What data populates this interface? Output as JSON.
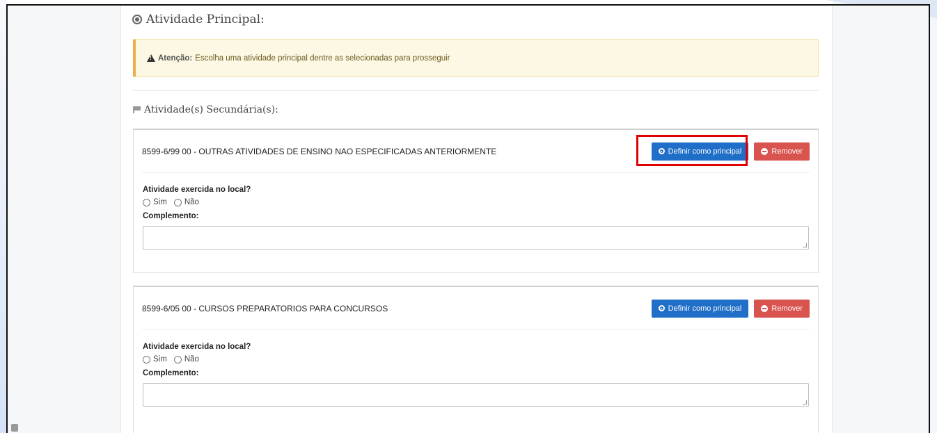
{
  "page": {
    "title": "Atividade Principal:"
  },
  "alert": {
    "strong": "Atenção:",
    "message": "Escolha uma atividade principal dentre as selecionadas para prosseguir"
  },
  "section": {
    "title": "Atividade(s) Secundária(s):"
  },
  "activities": [
    {
      "name": "8599-6/99 00 - OUTRAS ATIVIDADES DE ENSINO NAO ESPECIFICADAS ANTERIORMENTE",
      "define_label": "Definir como principal",
      "remove_label": "Remover",
      "question": "Atividade exercida no local?",
      "option_yes": "Sim",
      "option_no": "Não",
      "complement_label": "Complemento:",
      "complement_value": ""
    },
    {
      "name": "8599-6/05 00 - CURSOS PREPARATORIOS PARA CONCURSOS",
      "define_label": "Definir como principal",
      "remove_label": "Remover",
      "question": "Atividade exercida no local?",
      "option_yes": "Sim",
      "option_no": "Não",
      "complement_label": "Complemento:",
      "complement_value": ""
    }
  ],
  "colors": {
    "primary": "#1f6ec7",
    "danger": "#d9534f",
    "highlight": "#e10000",
    "alert_bg": "#fcf8e3"
  }
}
